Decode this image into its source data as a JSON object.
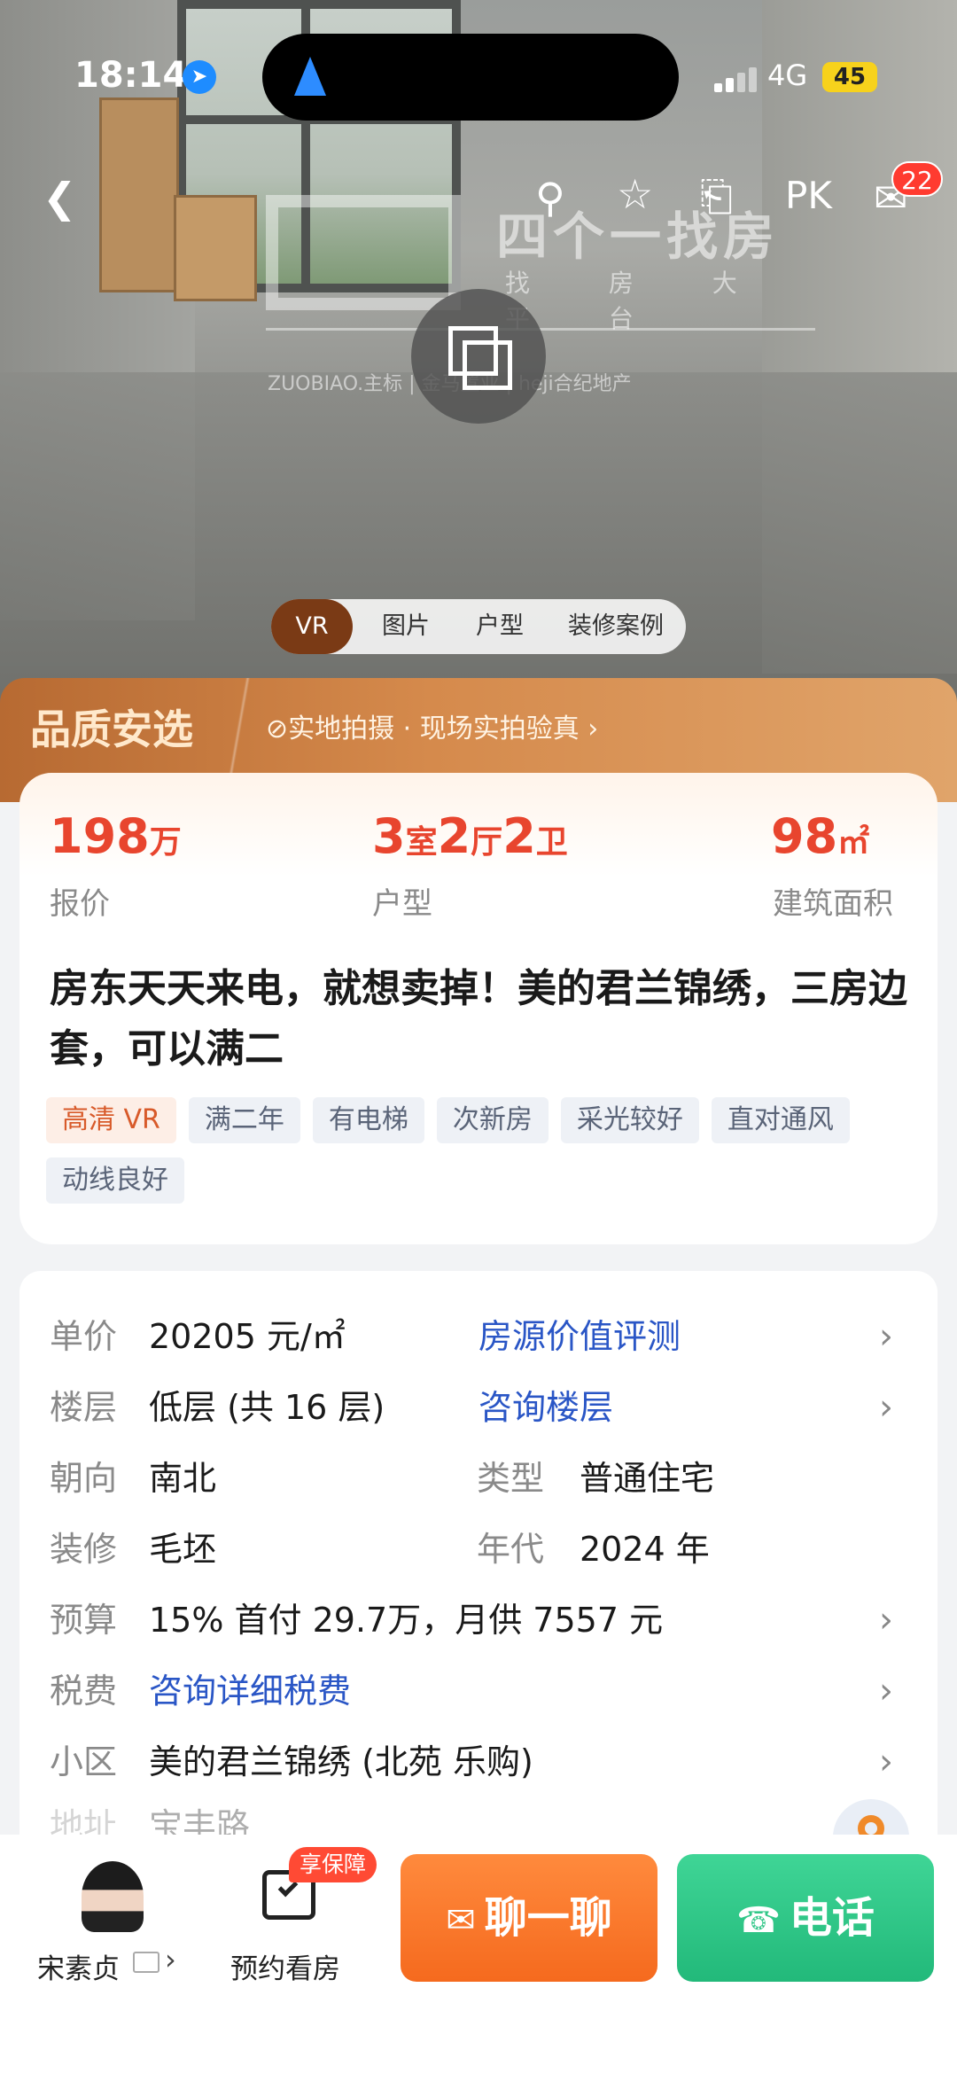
{
  "status": {
    "time": "18:14",
    "network": "4G",
    "battery": "45"
  },
  "topnav": {
    "pk": "PK",
    "message_count": "22"
  },
  "watermark": {
    "brand": "四个一找房",
    "sub": "找 房 大 平 台",
    "partners": "ZUOBIAO.主标 | 金马置业 | heji合纪地产"
  },
  "media_tabs": [
    "VR",
    "图片",
    "户型",
    "装修案例"
  ],
  "quality": {
    "title": "品质安选",
    "text": "⊘实地拍摄 · 现场实拍验真 ›"
  },
  "stats": {
    "price": {
      "value": "198",
      "unit": "万",
      "label": "报价"
    },
    "layout": {
      "r": "3",
      "r_unit": "室",
      "h": "2",
      "h_unit": "厅",
      "b": "2",
      "b_unit": "卫",
      "label": "户型"
    },
    "area": {
      "value": "98",
      "unit": "㎡",
      "label": "建筑面积"
    }
  },
  "headline": "房东天天来电，就想卖掉！美的君兰锦绣，三房边套，可以满二",
  "tags": [
    "高清 VR",
    "满二年",
    "有电梯",
    "次新房",
    "采光较好",
    "直对通风",
    "动线良好"
  ],
  "info": {
    "unit_price": {
      "k": "单价",
      "v": "20205 元/㎡",
      "link": "房源价值评测"
    },
    "floor": {
      "k": "楼层",
      "v": "低层 (共 16 层)",
      "link": "咨询楼层"
    },
    "orientation": {
      "k": "朝向",
      "v": "南北",
      "k2": "类型",
      "v2": "普通住宅"
    },
    "decoration": {
      "k": "装修",
      "v": "毛坯",
      "k2": "年代",
      "v2": "2024 年"
    },
    "budget": {
      "k": "预算",
      "v": "15% 首付 29.7万，月供 7557 元"
    },
    "tax": {
      "k": "税费",
      "v": "咨询详细税费"
    },
    "community": {
      "k": "小区",
      "v": "美的君兰锦绣 (北苑 乐购)"
    },
    "address": {
      "k": "地址",
      "v": "宝丰路"
    }
  },
  "bottom": {
    "agent_name": "宋素贞",
    "appt_badge": "享保障",
    "appt_label": "预约看房",
    "chat": "聊一聊",
    "call": "电话"
  }
}
